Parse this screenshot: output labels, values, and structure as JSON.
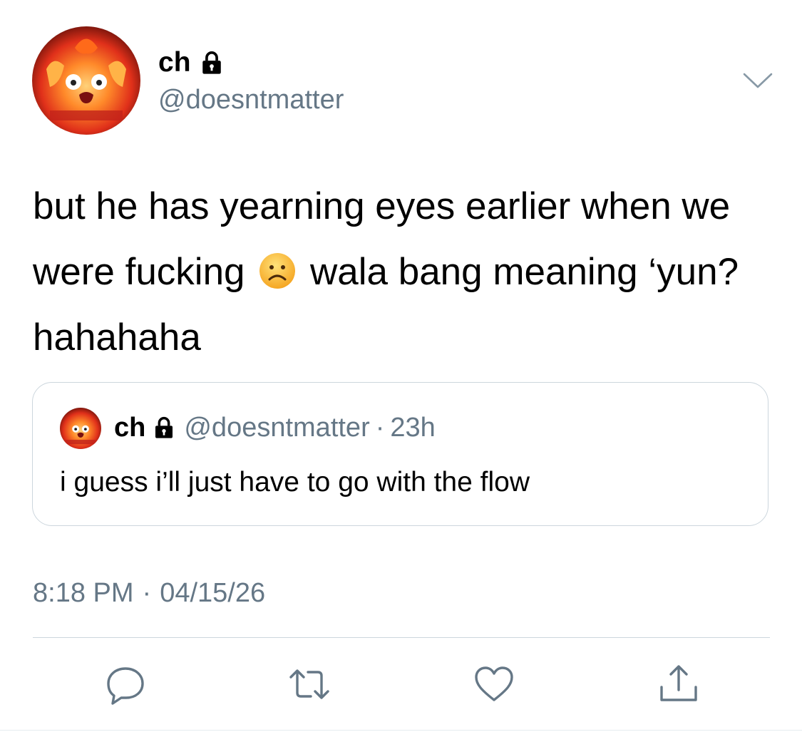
{
  "tweet": {
    "display_name": "ch",
    "handle": "@doesntmatter",
    "text_part1": "but he has yearning eyes earlier when we were fucking",
    "text_emoji": "☹",
    "text_part2": "wala bang meaning ‘yun? hahahaha",
    "time": "8:18 PM",
    "separator": "·",
    "date": "04/15/26"
  },
  "quoted": {
    "display_name": "ch",
    "handle": "@doesntmatter",
    "separator": "·",
    "time": "23h",
    "text": "i guess i’ll just have to go with the flow"
  },
  "icons": {
    "lock": "lock-icon",
    "caret": "chevron-down-icon",
    "reply": "reply-icon",
    "retweet": "retweet-icon",
    "like": "heart-icon",
    "share": "share-icon"
  },
  "colors": {
    "secondary_text": "#657786",
    "border": "#ccd6dd",
    "icon": "#657786"
  }
}
